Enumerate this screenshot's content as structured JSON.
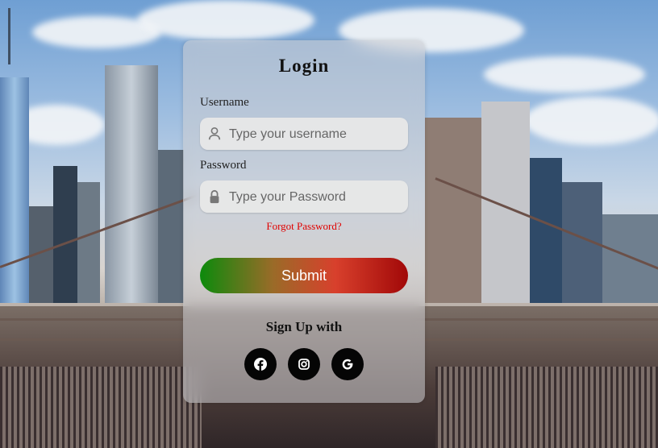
{
  "login": {
    "title": "Login",
    "username_label": "Username",
    "username_placeholder": "Type your username",
    "password_label": "Password",
    "password_placeholder": "Type your Password",
    "forgot_label": "Forgot Password?",
    "submit_label": "Submit",
    "signup_label": "Sign Up with"
  },
  "social": [
    "facebook-icon",
    "instagram-icon",
    "google-icon"
  ],
  "colors": {
    "card_bg": "#cdcdd2",
    "forgot": "#e00000",
    "submit_start": "#0c8a0c",
    "submit_end": "#a10808",
    "social_bg": "#050505"
  }
}
